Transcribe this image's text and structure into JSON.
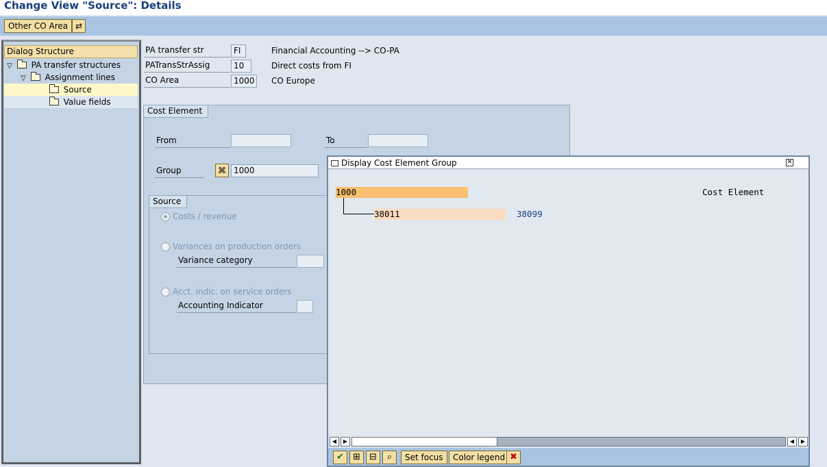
{
  "title": "Change View \"Source\": Details",
  "toolbar": {
    "other_co_area": "Other CO Area"
  },
  "tree": {
    "header": "Dialog Structure",
    "items": [
      {
        "label": "PA transfer structures"
      },
      {
        "label": "Assignment lines"
      },
      {
        "label": "Source"
      },
      {
        "label": "Value fields"
      }
    ]
  },
  "header_fields": {
    "pa_transfer_str_label": "PA transfer str",
    "pa_transfer_str_value": "FI",
    "pa_transfer_str_desc": "Financial Accounting --> CO-PA",
    "patransstrassig_label": "PATransStrAssig",
    "patransstrassig_value": "10",
    "patransstrassig_desc": "Direct costs from FI",
    "co_area_label": "CO Area",
    "co_area_value": "1000",
    "co_area_desc": "CO Europe"
  },
  "cost_element": {
    "tab": "Cost Element",
    "from_label": "From",
    "from_value": "",
    "to_label": "To",
    "to_value": "",
    "group_label": "Group",
    "group_value": "1000"
  },
  "source": {
    "tab": "Source",
    "opt_costs": "Costs / revenue",
    "opt_variances": "Variances on production orders",
    "variance_category_label": "Variance category",
    "opt_acct": "Acct. indic. on service orders",
    "accounting_indicator_label": "Accounting Indicator"
  },
  "popup": {
    "title": "Display Cost Element Group",
    "root_node": "1000",
    "column_header": "Cost Element",
    "child_from": "38011",
    "child_to": "38099",
    "set_focus": "Set focus",
    "color_legend": "Color legend"
  },
  "colors": {
    "root_highlight": "#f8c070",
    "child_highlight": "#fbdcc0",
    "title_color": "#183f7d"
  }
}
